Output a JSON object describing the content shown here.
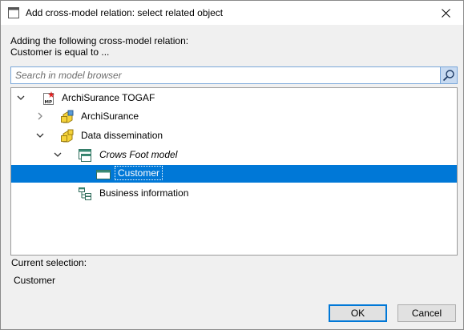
{
  "window": {
    "title": "Add cross-model relation: select related object",
    "app_icon": "app-dialog-icon",
    "close_icon": "close-icon"
  },
  "description": {
    "line1": "Adding the following cross-model relation:",
    "line2": "Customer is equal to ..."
  },
  "search": {
    "placeholder": "Search in model browser",
    "value": "",
    "icon": "search-icon"
  },
  "tree": {
    "nodes": [
      {
        "label": "ArchiSurance TOGAF",
        "icon": "model-package-icon",
        "expander": "expanded",
        "selected": false,
        "italic": false
      },
      {
        "label": "ArchiSurance",
        "icon": "folder-model-icon",
        "expander": "collapsed",
        "selected": false,
        "italic": false
      },
      {
        "label": "Data dissemination",
        "icon": "folder-model-icon",
        "expander": "expanded",
        "selected": false,
        "italic": false
      },
      {
        "label": "Crows Foot model",
        "icon": "diagram-icon",
        "expander": "expanded",
        "selected": false,
        "italic": true
      },
      {
        "label": "Customer",
        "icon": "entity-icon",
        "expander": "none",
        "selected": true,
        "italic": false
      },
      {
        "label": "Business information",
        "icon": "diagram-tree-icon",
        "expander": "none",
        "selected": false,
        "italic": false
      }
    ]
  },
  "current_selection": {
    "label": "Current selection:",
    "value": "Customer"
  },
  "buttons": {
    "ok": "OK",
    "cancel": "Cancel"
  },
  "colors": {
    "selection": "#0078d7",
    "search_button": "#c7daf1",
    "folder_yellow": "#f5d33b"
  }
}
